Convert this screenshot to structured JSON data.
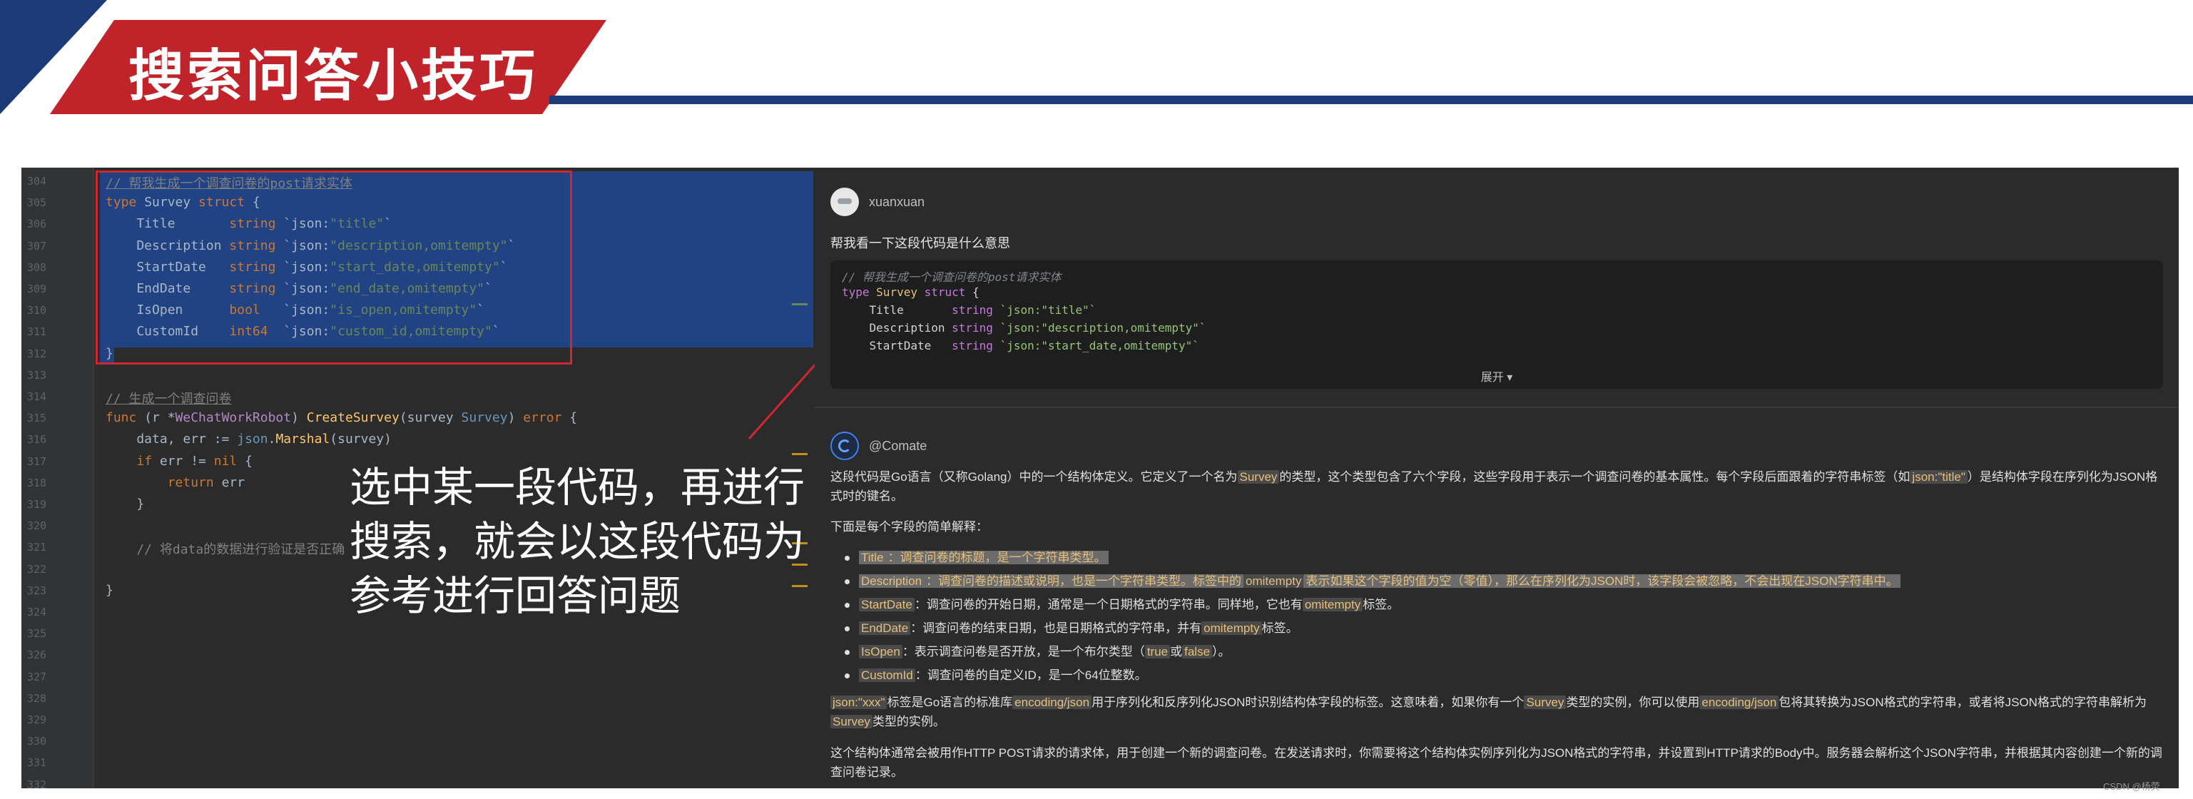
{
  "header": {
    "title": "搜索问答小技巧"
  },
  "editor": {
    "line_numbers": [
      "304",
      "305",
      "306",
      "307",
      "308",
      "309",
      "310",
      "311",
      "312",
      "313",
      "314",
      "315",
      "316",
      "317",
      "318",
      "319",
      "320",
      "321",
      "322",
      "323",
      "324",
      "325",
      "326",
      "327",
      "328",
      "329",
      "330",
      "331",
      "332"
    ],
    "code_lines": [
      {
        "parts": [
          [
            "cmu",
            "// 帮我生成一个调查问卷的post请求实体"
          ]
        ]
      },
      {
        "parts": [
          [
            "kw",
            "type "
          ],
          [
            "pl",
            "Survey "
          ],
          [
            "kw",
            "struct "
          ],
          [
            "pl",
            "{"
          ]
        ]
      },
      {
        "parts": [
          [
            "pl",
            "    Title       "
          ],
          [
            "kw",
            "string "
          ],
          [
            "pl",
            "`json:"
          ],
          [
            "str",
            "\"title\""
          ],
          [
            "pl",
            "`"
          ]
        ]
      },
      {
        "parts": [
          [
            "pl",
            "    Description "
          ],
          [
            "kw",
            "string "
          ],
          [
            "pl",
            "`json:"
          ],
          [
            "str",
            "\"description,omitempty\""
          ],
          [
            "pl",
            "`"
          ]
        ]
      },
      {
        "parts": [
          [
            "pl",
            "    StartDate   "
          ],
          [
            "kw",
            "string "
          ],
          [
            "pl",
            "`json:"
          ],
          [
            "str",
            "\"start_date,omitempty\""
          ],
          [
            "pl",
            "`"
          ]
        ]
      },
      {
        "parts": [
          [
            "pl",
            "    EndDate     "
          ],
          [
            "kw",
            "string "
          ],
          [
            "pl",
            "`json:"
          ],
          [
            "str",
            "\"end_date,omitempty\""
          ],
          [
            "pl",
            "`"
          ]
        ]
      },
      {
        "parts": [
          [
            "pl",
            "    IsOpen      "
          ],
          [
            "kw",
            "bool   "
          ],
          [
            "pl",
            "`json:"
          ],
          [
            "str",
            "\"is_open,omitempty\""
          ],
          [
            "pl",
            "`"
          ]
        ]
      },
      {
        "parts": [
          [
            "pl",
            "    CustomId    "
          ],
          [
            "kw",
            "int64  "
          ],
          [
            "pl",
            "`json:"
          ],
          [
            "str",
            "\"custom_id,omitempty\""
          ],
          [
            "pl",
            "`"
          ]
        ]
      },
      {
        "parts": [
          [
            "pl",
            "}"
          ]
        ]
      },
      {
        "parts": []
      },
      {
        "parts": [
          [
            "cmu",
            "// 生成一个调查问卷"
          ]
        ]
      },
      {
        "parts": [
          [
            "kw",
            "func "
          ],
          [
            "pl",
            "(r *"
          ],
          [
            "ty2",
            "WeChatWorkRobot"
          ],
          [
            "pl",
            ") "
          ],
          [
            "fn",
            "CreateSurvey"
          ],
          [
            "pl",
            "(survey "
          ],
          [
            "ty",
            "Survey"
          ],
          [
            "pl",
            ") "
          ],
          [
            "kw",
            "error "
          ],
          [
            "pl",
            "{"
          ]
        ]
      },
      {
        "parts": [
          [
            "pl",
            "    data, err := "
          ],
          [
            "ty",
            "json"
          ],
          [
            "pl",
            "."
          ],
          [
            "fn",
            "Marshal"
          ],
          [
            "pl",
            "(survey)"
          ]
        ]
      },
      {
        "parts": [
          [
            "pl",
            "    "
          ],
          [
            "kw",
            "if "
          ],
          [
            "pl",
            "err != "
          ],
          [
            "kw",
            "nil "
          ],
          [
            "pl",
            "{"
          ]
        ]
      },
      {
        "parts": [
          [
            "pl",
            "        "
          ],
          [
            "kw",
            "return "
          ],
          [
            "pl",
            "err"
          ]
        ]
      },
      {
        "parts": [
          [
            "pl",
            "    }"
          ]
        ]
      },
      {
        "parts": []
      },
      {
        "parts": [
          [
            "cm",
            "    // 将data的数据进行验证是否正确"
          ]
        ]
      },
      {
        "parts": []
      },
      {
        "parts": [
          [
            "pl",
            "}"
          ]
        ]
      }
    ]
  },
  "overlay_text": "选中某一段代码，再进行搜索，就会以这段代码为参考进行回答问题",
  "chat": {
    "user_name": "xuanxuan",
    "question": "帮我看一下这段代码是什么意思",
    "snippet_lines": [
      "// 帮我生成一个调查问卷的post请求实体",
      "type Survey struct {",
      "    Title       string `json:\"title\"`",
      "    Description string `json:\"description,omitempty\"`",
      "    StartDate   string `json:\"start_date,omitempty\"`"
    ],
    "expand_label": "展开 ▾",
    "bot_name": "@Comate",
    "answer": {
      "p1_a": "这段代码是Go语言（又称Golang）中的一个结构体定义。它定义了一个名为",
      "p1_survey": "Survey",
      "p1_b": "的类型，这个类型包含了六个字段，这些字段用于表示一个调查问卷的基本属性。每个字段后面跟着的字符串标签（如",
      "p1_tag": "json:\"title\"",
      "p1_c": "）是结构体字段在序列化为JSON格式时的键名。",
      "p2": "下面是每个字段的简单解释：",
      "items": [
        {
          "name": "Title",
          "text": "：调查问卷的标题，是一个字符串类型。"
        },
        {
          "name": "Description",
          "text_a": "：调查问卷的描述或说明，也是一个字符串类型。标签中的",
          "tag": "omitempty",
          "text_b": "表示如果这个字段的值为空（零值），那么在序列化为JSON时，该字段会被忽略，不会出现在JSON字符串中。"
        },
        {
          "name": "StartDate",
          "text_a": "：调查问卷的开始日期，通常是一个日期格式的字符串。同样地，它也有",
          "tag": "omitempty",
          "text_b": "标签。"
        },
        {
          "name": "EndDate",
          "text_a": "：调查问卷的结束日期，也是日期格式的字符串，并有",
          "tag": "omitempty",
          "text_b": "标签。"
        },
        {
          "name": "IsOpen",
          "text_a": "：表示调查问卷是否开放，是一个布尔类型（",
          "t1": "true",
          "mid": "或",
          "t2": "false",
          "text_b": "）。"
        },
        {
          "name": "CustomId",
          "text": "：调查问卷的自定义ID，是一个64位整数。"
        }
      ],
      "p3_tag": "json:\"xxx\"",
      "p3_a": "标签是Go语言的标准库",
      "p3_lib": "encoding/json",
      "p3_b": "用于序列化和反序列化JSON时识别结构体字段的标签。这意味着，如果你有一个",
      "p3_survey": "Survey",
      "p3_c": "类型的实例，你可以使用",
      "p3_lib2": "encoding/json",
      "p3_d": "包将其转换为JSON格式的字符串，或者将JSON格式的字符串解析为",
      "p3_survey2": "Survey",
      "p3_e": "类型的实例。",
      "p4": "这个结构体通常会被用作HTTP POST请求的请求体，用于创建一个新的调查问卷。在发送请求时，你需要将这个结构体实例序列化为JSON格式的字符串，并设置到HTTP请求的Body中。服务器会解析这个JSON字符串，并根据其内容创建一个新的调查问卷记录。"
    }
  },
  "watermark": "CSDN @杨荧",
  "colors": {
    "banner_red": "#c0232a",
    "banner_blue": "#1c3a78",
    "selection": "#214283",
    "annotation_red": "#d0262f"
  }
}
